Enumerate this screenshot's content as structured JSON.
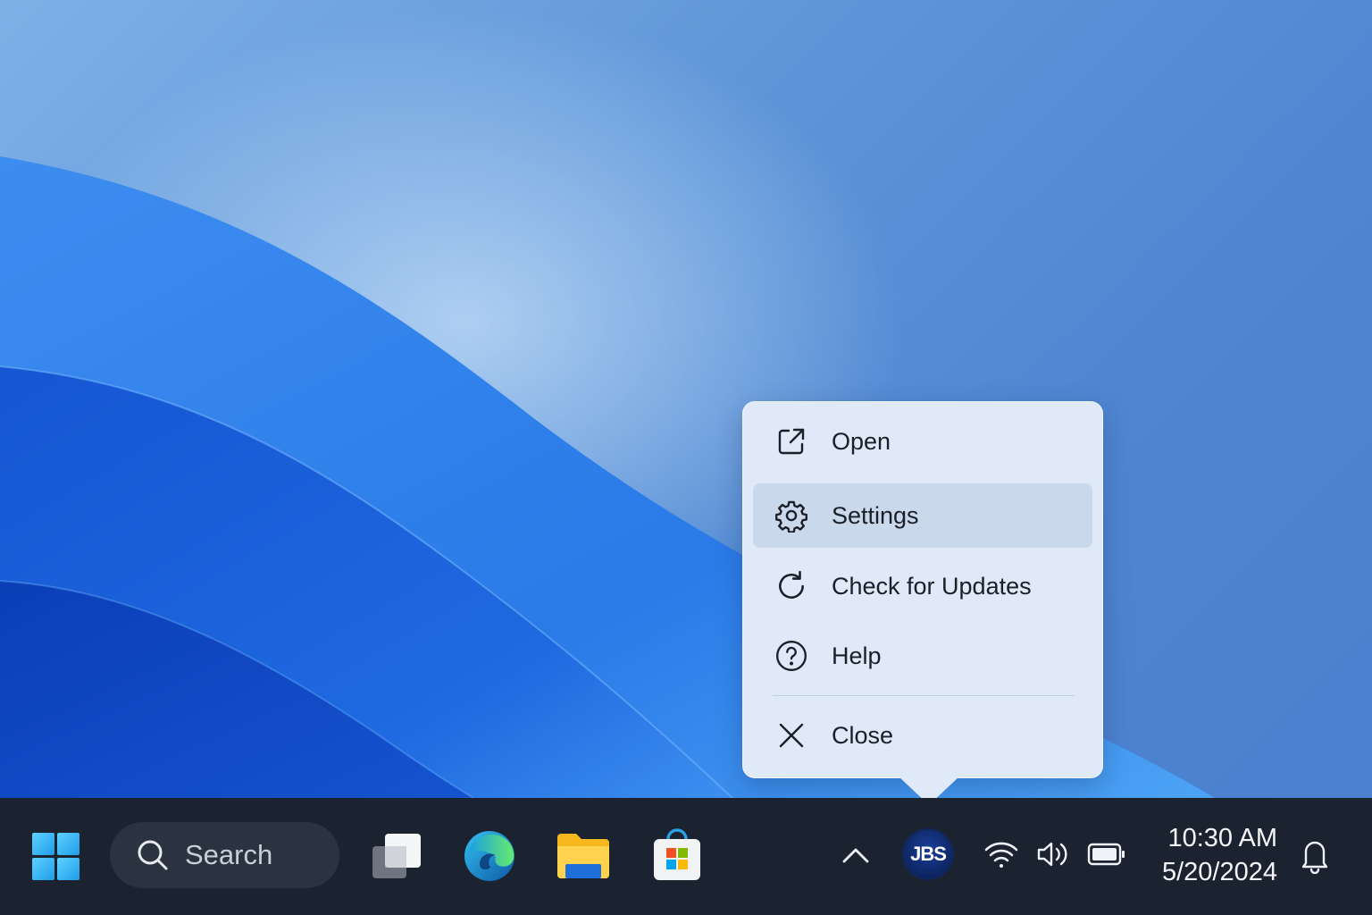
{
  "context_menu": {
    "items": [
      {
        "label": "Open",
        "icon": "open-external-icon"
      },
      {
        "label": "Settings",
        "icon": "gear-icon",
        "highlighted": true
      },
      {
        "label": "Check for Updates",
        "icon": "refresh-icon"
      },
      {
        "label": "Help",
        "icon": "help-circle-icon"
      },
      {
        "label": "Close",
        "icon": "close-icon"
      }
    ]
  },
  "taskbar": {
    "search_label": "Search",
    "tray_app_badge": "JBS",
    "time": "10:30 AM",
    "date": "5/20/2024",
    "pinned_apps": [
      "start-icon",
      "task-view-icon",
      "edge-icon",
      "file-explorer-icon",
      "store-icon"
    ],
    "tray_icons": [
      "chevron-up-icon",
      "wifi-icon",
      "volume-icon",
      "battery-icon",
      "notification-bell-icon"
    ]
  },
  "colors": {
    "taskbar_bg": "#1b2230",
    "menu_bg": "#dfe9f7",
    "menu_highlight": "#cad8ec",
    "wallpaper_blue": "#1f6fe0"
  }
}
